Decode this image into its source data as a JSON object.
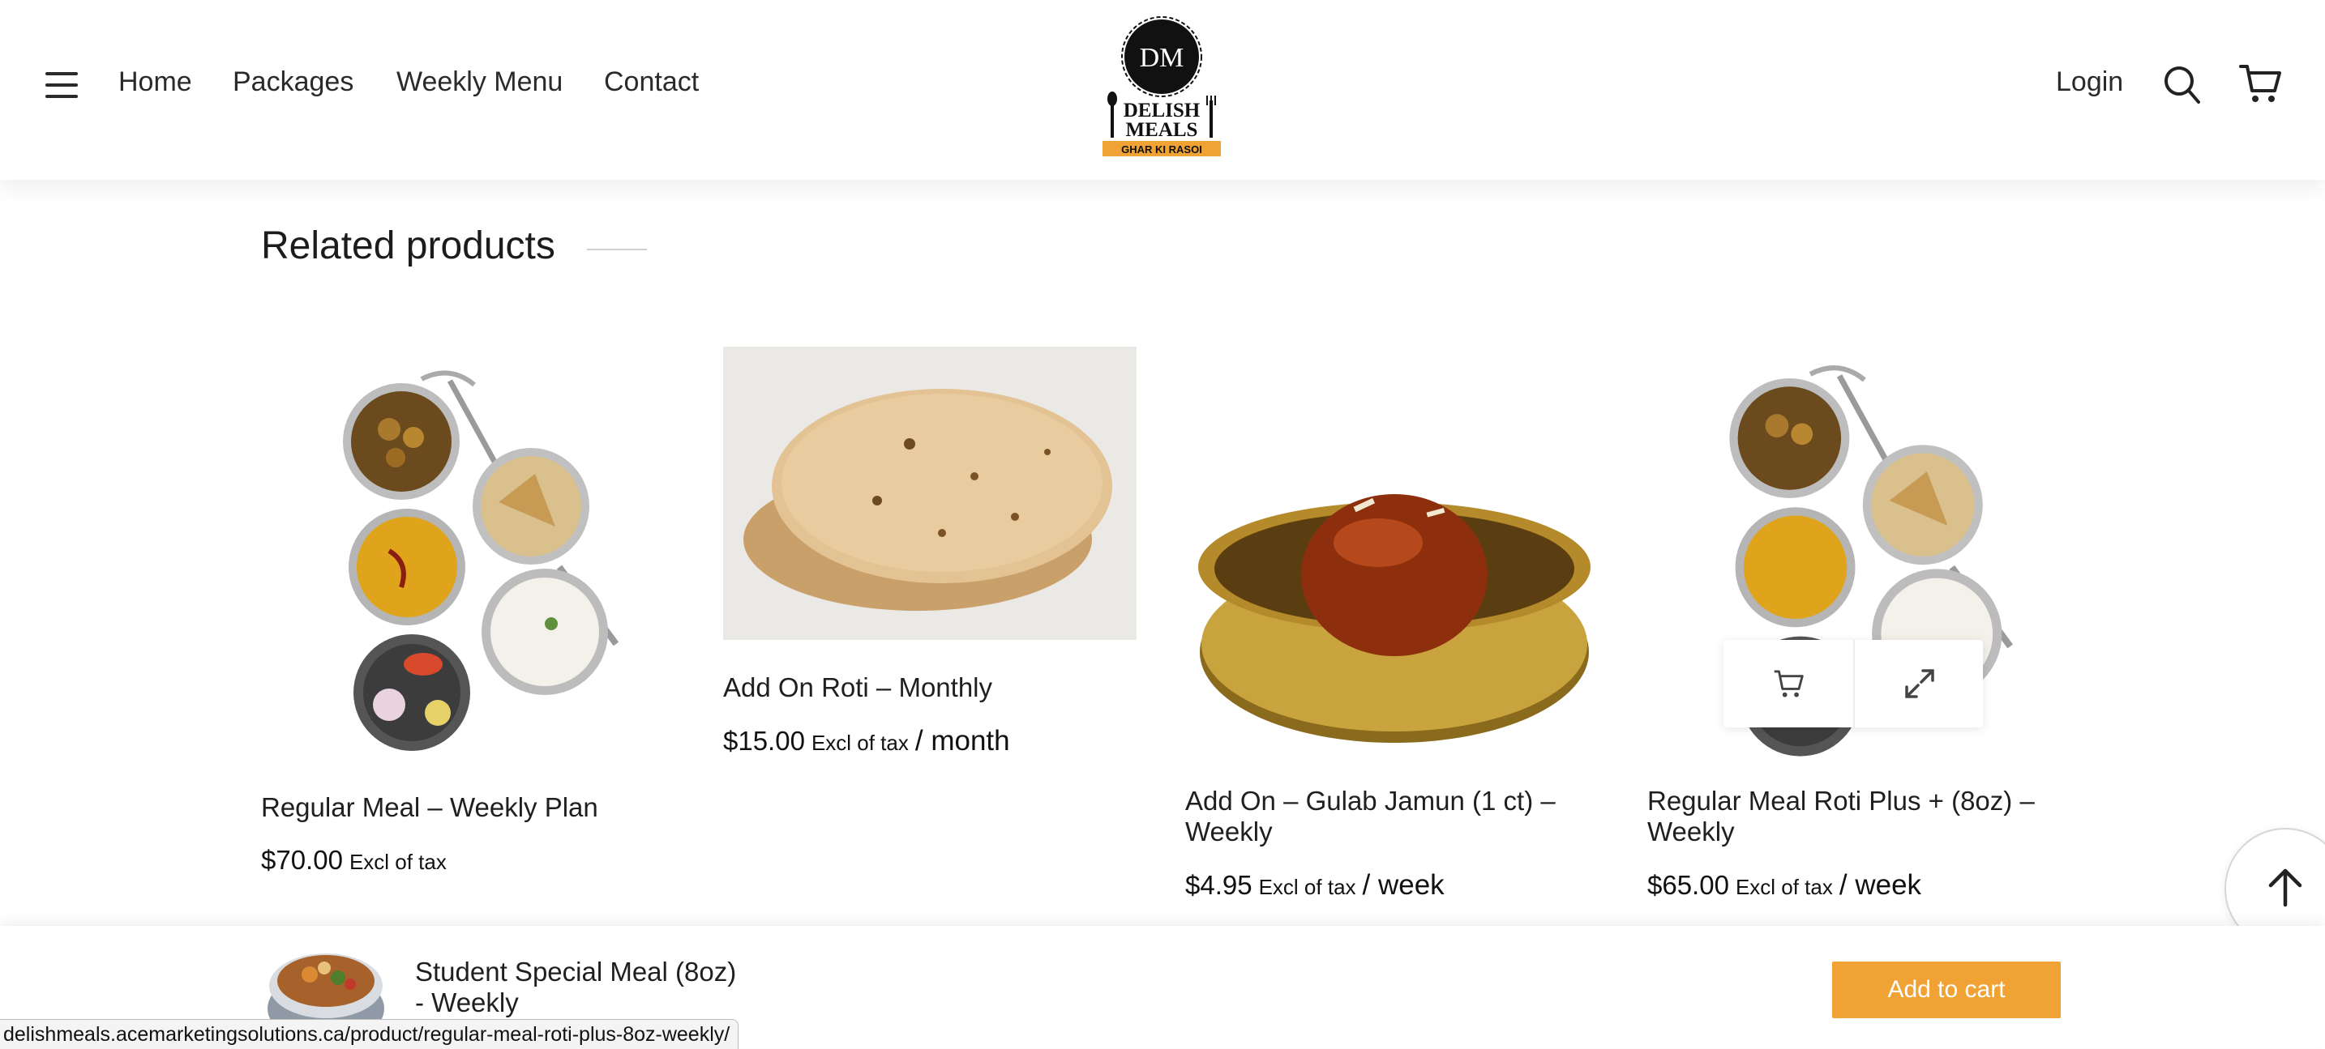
{
  "header": {
    "nav": [
      "Home",
      "Packages",
      "Weekly Menu",
      "Contact"
    ],
    "login": "Login",
    "logo": {
      "initials": "DM",
      "line1": "DELISH",
      "line2": "MEALS",
      "tagline": "GHAR KI RASOI"
    }
  },
  "related": {
    "title": "Related products",
    "products": [
      {
        "title": "Regular Meal – Weekly Plan",
        "price": "$70.00",
        "tax": "Excl of tax",
        "period": ""
      },
      {
        "title": "Add On Roti – Monthly",
        "price": "$15.00",
        "tax": "Excl of tax",
        "period": "/ month"
      },
      {
        "title": "Add On – Gulab Jamun (1 ct) – Weekly",
        "price": "$4.95",
        "tax": "Excl of tax",
        "period": "/ week"
      },
      {
        "title": "Regular Meal Roti Plus + (8oz) – Weekly",
        "price": "$65.00",
        "tax": "Excl of tax",
        "period": "/ week"
      }
    ]
  },
  "sticky": {
    "product_name": "Student Special Meal (8oz) - Weekly",
    "add_to_cart": "Add to cart"
  },
  "status_bar": {
    "url": "delishmeals.acemarketingsolutions.ca/product/regular-meal-roti-plus-8oz-weekly/"
  },
  "colors": {
    "accent": "#f0a234",
    "text": "#1f1f1f"
  },
  "icons": [
    "menu-icon",
    "search-icon",
    "cart-icon",
    "arrow-up-icon",
    "expand-icon"
  ]
}
